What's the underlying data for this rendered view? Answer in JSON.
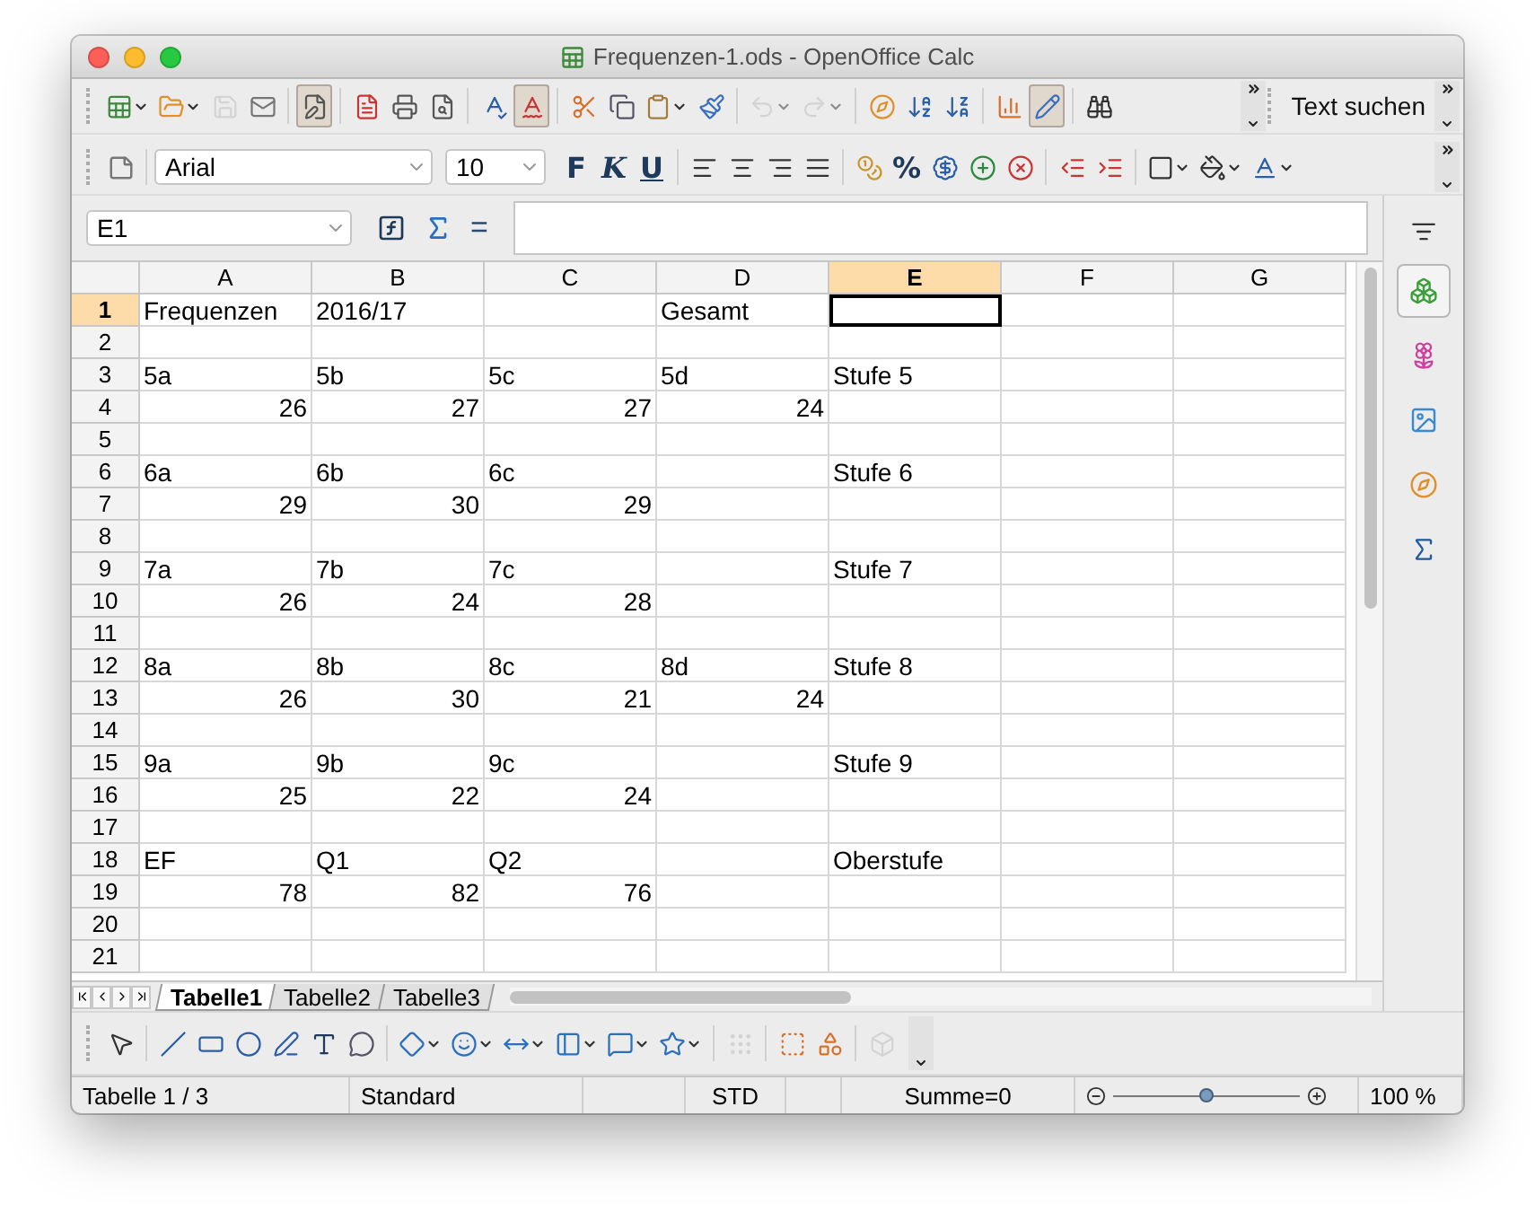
{
  "window": {
    "title": "Frequenzen-1.ods - OpenOffice Calc"
  },
  "standard_toolbar": [
    {
      "kind": "new",
      "caret": true,
      "pressed": false,
      "disabled": false
    },
    {
      "kind": "open",
      "caret": true,
      "pressed": false,
      "disabled": false
    },
    {
      "kind": "save",
      "caret": false,
      "pressed": false,
      "disabled": true
    },
    {
      "kind": "mail",
      "caret": false,
      "pressed": false,
      "disabled": false
    },
    {
      "kind": "sep"
    },
    {
      "kind": "edit",
      "caret": false,
      "pressed": true,
      "disabled": false
    },
    {
      "kind": "sep"
    },
    {
      "kind": "pdf",
      "caret": false,
      "pressed": false,
      "disabled": false
    },
    {
      "kind": "print",
      "caret": false,
      "pressed": false,
      "disabled": false
    },
    {
      "kind": "preview",
      "caret": false,
      "pressed": false,
      "disabled": false
    },
    {
      "kind": "sep"
    },
    {
      "kind": "spell",
      "caret": false,
      "pressed": false,
      "disabled": false
    },
    {
      "kind": "autospell",
      "caret": false,
      "pressed": true,
      "disabled": false
    },
    {
      "kind": "sep"
    },
    {
      "kind": "cut",
      "caret": false,
      "pressed": false,
      "disabled": false
    },
    {
      "kind": "copy",
      "caret": false,
      "pressed": false,
      "disabled": false
    },
    {
      "kind": "paste",
      "caret": true,
      "pressed": false,
      "disabled": false
    },
    {
      "kind": "brush",
      "caret": false,
      "pressed": false,
      "disabled": false
    },
    {
      "kind": "sep"
    },
    {
      "kind": "undo",
      "caret": true,
      "pressed": false,
      "disabled": true
    },
    {
      "kind": "redo",
      "caret": true,
      "pressed": false,
      "disabled": true
    },
    {
      "kind": "sep"
    },
    {
      "kind": "navigator",
      "caret": false,
      "pressed": false,
      "disabled": false
    },
    {
      "kind": "sort-asc",
      "caret": false,
      "pressed": false,
      "disabled": false
    },
    {
      "kind": "sort-desc",
      "caret": false,
      "pressed": false,
      "disabled": false
    },
    {
      "kind": "sep"
    },
    {
      "kind": "chart",
      "caret": false,
      "pressed": false,
      "disabled": false
    },
    {
      "kind": "draw",
      "caret": false,
      "pressed": true,
      "disabled": false
    },
    {
      "kind": "sep"
    },
    {
      "kind": "find",
      "caret": false,
      "pressed": false,
      "disabled": false
    }
  ],
  "search_toolbar": {
    "label": "Text suchen"
  },
  "format_toolbar": {
    "font": "Arial",
    "size": "10",
    "items": [
      {
        "kind": "bold",
        "label": "F"
      },
      {
        "kind": "italic",
        "label": "K"
      },
      {
        "kind": "underline",
        "label": "U"
      },
      {
        "kind": "sep"
      },
      {
        "kind": "align-left"
      },
      {
        "kind": "align-center"
      },
      {
        "kind": "align-right"
      },
      {
        "kind": "align-justify"
      },
      {
        "kind": "sep"
      },
      {
        "kind": "currency"
      },
      {
        "kind": "percent",
        "label": "%"
      },
      {
        "kind": "standard-format"
      },
      {
        "kind": "add-decimal"
      },
      {
        "kind": "delete-decimal"
      },
      {
        "kind": "sep"
      },
      {
        "kind": "outdent"
      },
      {
        "kind": "indent"
      },
      {
        "kind": "sep"
      },
      {
        "kind": "borders",
        "caret": true
      },
      {
        "kind": "background",
        "caret": true
      },
      {
        "kind": "font-color",
        "caret": true
      }
    ]
  },
  "formula_bar": {
    "name_box": "E1",
    "equals": "="
  },
  "columns": [
    {
      "label": "A",
      "selected": false
    },
    {
      "label": "B",
      "selected": false
    },
    {
      "label": "C",
      "selected": false
    },
    {
      "label": "D",
      "selected": false
    },
    {
      "label": "E",
      "selected": true
    },
    {
      "label": "F",
      "selected": false
    },
    {
      "label": "G",
      "selected": false
    }
  ],
  "rows": [
    {
      "number": "1",
      "selected": true,
      "kind": "labels",
      "cells": [
        "Frequenzen",
        "2016/17",
        "",
        "Gesamt",
        "",
        "",
        ""
      ]
    },
    {
      "number": "2",
      "selected": false,
      "kind": "labels",
      "cells": [
        "",
        "",
        "",
        "",
        "",
        "",
        ""
      ]
    },
    {
      "number": "3",
      "selected": false,
      "kind": "labels",
      "cells": [
        "5a",
        "5b",
        "5c",
        "5d",
        "Stufe 5",
        "",
        ""
      ]
    },
    {
      "number": "4",
      "selected": false,
      "kind": "numbers",
      "cells": [
        "26",
        "27",
        "27",
        "24",
        "",
        "",
        ""
      ]
    },
    {
      "number": "5",
      "selected": false,
      "kind": "labels",
      "cells": [
        "",
        "",
        "",
        "",
        "",
        "",
        ""
      ]
    },
    {
      "number": "6",
      "selected": false,
      "kind": "labels",
      "cells": [
        "6a",
        "6b",
        "6c",
        "",
        "Stufe 6",
        "",
        ""
      ]
    },
    {
      "number": "7",
      "selected": false,
      "kind": "numbers",
      "cells": [
        "29",
        "30",
        "29",
        "",
        "",
        "",
        ""
      ]
    },
    {
      "number": "8",
      "selected": false,
      "kind": "labels",
      "cells": [
        "",
        "",
        "",
        "",
        "",
        "",
        ""
      ]
    },
    {
      "number": "9",
      "selected": false,
      "kind": "labels",
      "cells": [
        "7a",
        "7b",
        "7c",
        "",
        "Stufe 7",
        "",
        ""
      ]
    },
    {
      "number": "10",
      "selected": false,
      "kind": "numbers",
      "cells": [
        "26",
        "24",
        "28",
        "",
        "",
        "",
        ""
      ]
    },
    {
      "number": "11",
      "selected": false,
      "kind": "labels",
      "cells": [
        "",
        "",
        "",
        "",
        "",
        "",
        ""
      ]
    },
    {
      "number": "12",
      "selected": false,
      "kind": "labels",
      "cells": [
        "8a",
        "8b",
        "8c",
        "8d",
        "Stufe 8",
        "",
        ""
      ]
    },
    {
      "number": "13",
      "selected": false,
      "kind": "numbers",
      "cells": [
        "26",
        "30",
        "21",
        "24",
        "",
        "",
        ""
      ]
    },
    {
      "number": "14",
      "selected": false,
      "kind": "labels",
      "cells": [
        "",
        "",
        "",
        "",
        "",
        "",
        ""
      ]
    },
    {
      "number": "15",
      "selected": false,
      "kind": "labels",
      "cells": [
        "9a",
        "9b",
        "9c",
        "",
        "Stufe 9",
        "",
        ""
      ]
    },
    {
      "number": "16",
      "selected": false,
      "kind": "numbers",
      "cells": [
        "25",
        "22",
        "24",
        "",
        "",
        "",
        ""
      ]
    },
    {
      "number": "17",
      "selected": false,
      "kind": "labels",
      "cells": [
        "",
        "",
        "",
        "",
        "",
        "",
        ""
      ]
    },
    {
      "number": "18",
      "selected": false,
      "kind": "labels",
      "cells": [
        "EF",
        "Q1",
        "Q2",
        "",
        "Oberstufe",
        "",
        ""
      ]
    },
    {
      "number": "19",
      "selected": false,
      "kind": "numbers",
      "cells": [
        "78",
        "82",
        "76",
        "",
        "",
        "",
        ""
      ]
    },
    {
      "number": "20",
      "selected": false,
      "kind": "labels",
      "cells": [
        "",
        "",
        "",
        "",
        "",
        "",
        ""
      ]
    },
    {
      "number": "21",
      "selected": false,
      "kind": "labels",
      "cells": [
        "",
        "",
        "",
        "",
        "",
        "",
        ""
      ]
    }
  ],
  "sheet_tabs": [
    {
      "label": "Tabelle1",
      "selected": true
    },
    {
      "label": "Tabelle2",
      "selected": false
    },
    {
      "label": "Tabelle3",
      "selected": false
    }
  ],
  "drawing_toolbar": [
    {
      "kind": "select",
      "caret": false,
      "disabled": false
    },
    {
      "kind": "sep"
    },
    {
      "kind": "line",
      "caret": false,
      "disabled": false
    },
    {
      "kind": "rectangle",
      "caret": false,
      "disabled": false
    },
    {
      "kind": "ellipse",
      "caret": false,
      "disabled": false
    },
    {
      "kind": "freeform",
      "caret": false,
      "disabled": false
    },
    {
      "kind": "text",
      "caret": false,
      "disabled": false
    },
    {
      "kind": "callout",
      "caret": false,
      "disabled": false
    },
    {
      "kind": "sep"
    },
    {
      "kind": "diamond",
      "caret": true,
      "disabled": false
    },
    {
      "kind": "smiley",
      "caret": true,
      "disabled": false
    },
    {
      "kind": "arrows",
      "caret": true,
      "disabled": false
    },
    {
      "kind": "flowchart",
      "caret": true,
      "disabled": false
    },
    {
      "kind": "speech",
      "caret": true,
      "disabled": false
    },
    {
      "kind": "star",
      "caret": true,
      "disabled": false
    },
    {
      "kind": "sep"
    },
    {
      "kind": "points",
      "caret": false,
      "disabled": true
    },
    {
      "kind": "sep"
    },
    {
      "kind": "fontwork",
      "caret": false,
      "disabled": false
    },
    {
      "kind": "shapes",
      "caret": false,
      "disabled": false
    },
    {
      "kind": "sep"
    },
    {
      "kind": "extrusion",
      "caret": false,
      "disabled": true
    }
  ],
  "sidebar": [
    {
      "kind": "properties",
      "selected": true
    },
    {
      "kind": "gallery",
      "selected": false
    },
    {
      "kind": "images",
      "selected": false
    },
    {
      "kind": "navigator",
      "selected": false
    },
    {
      "kind": "functions",
      "selected": false
    }
  ],
  "status_bar": {
    "sheet": "Tabelle 1 / 3",
    "style": "Standard",
    "mode": "STD",
    "sum": "Summe=0",
    "zoom": {
      "level": 0.5,
      "reading": "100 %"
    }
  }
}
